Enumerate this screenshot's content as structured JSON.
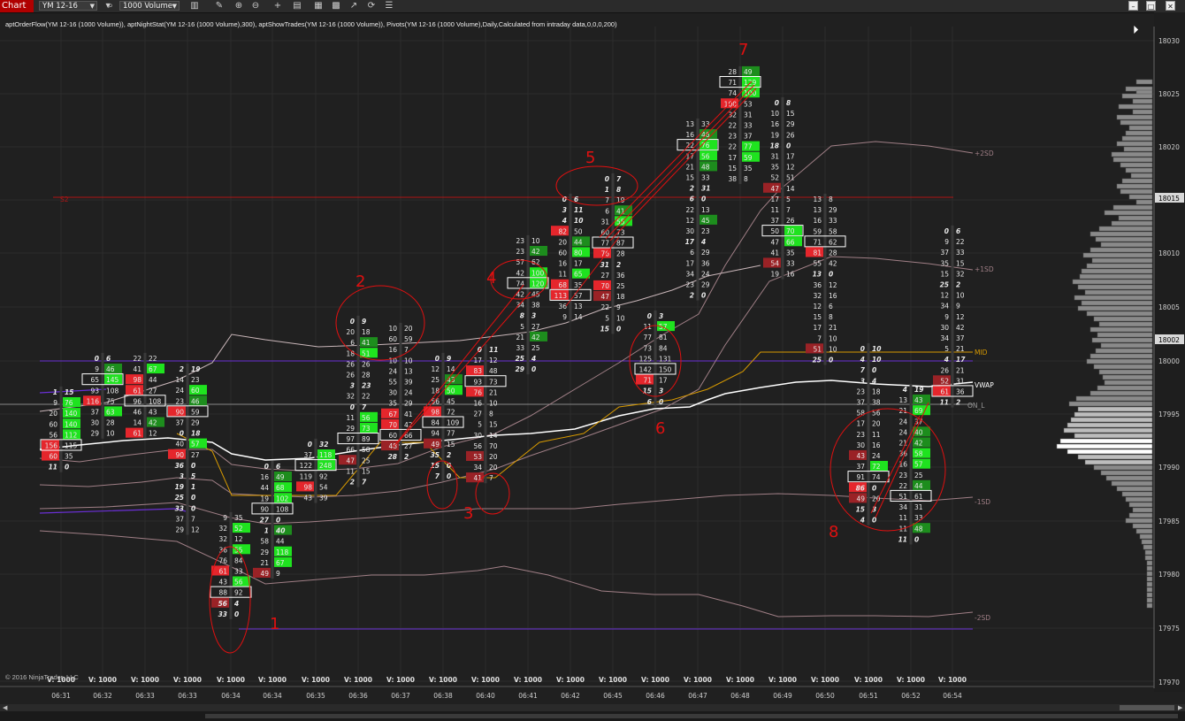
{
  "toolbar": {
    "chart_tab": "Chart",
    "instrument": "YM 12-16",
    "bar_type": "1000 Volume",
    "icons": [
      "bar-style-icon",
      "search-icon",
      "pencil-icon",
      "zoom-in-icon",
      "zoom-out-icon",
      "crosshair-icon",
      "properties-icon",
      "strategies-icon",
      "data-series-icon",
      "drawing-tools-icon",
      "refresh-icon",
      "menu-icon"
    ],
    "window_buttons": [
      "minimize",
      "maximize",
      "close"
    ]
  },
  "indicator_line": "aptOrderFlow(YM 12-16 (1000 Volume)), aptNightStat(YM 12-16 (1000 Volume),300), aptShowTrades(YM 12-16 (1000 Volume)), Pivots(YM 12-16 (1000 Volume),Daily,Calculated from intraday data,0,0,0,200)",
  "copyright": "© 2016 NinjaTrader, LLC",
  "colors": {
    "background": "#202020",
    "bid_strong": "#e5262c",
    "ask_strong": "#1fe31f",
    "annotation": "#e01010",
    "vwap": "#ffffff",
    "pivot_mid": "#d89a00",
    "pivot_s2": "#b01515",
    "on_level": "#9a40ff"
  },
  "price_axis": {
    "labels": [
      "18030",
      "18025",
      "18020",
      "18015",
      "18010",
      "18005",
      "18002",
      "18000",
      "17995",
      "17990",
      "17985",
      "17980",
      "17975",
      "17970"
    ],
    "current_labels": [
      "18015",
      "18002"
    ],
    "level_labels": [
      "+2SD",
      "+1SD",
      "MID",
      "VWAP",
      "ON_L",
      "-1SD",
      "-2SD",
      "S2"
    ]
  },
  "time_axis": {
    "labels": [
      "06:31",
      "06:32",
      "06:33",
      "06:33",
      "06:34",
      "06:34",
      "06:35",
      "06:36",
      "06:37",
      "06:38",
      "06:40",
      "06:41",
      "06:42",
      "06:45",
      "06:46",
      "06:47",
      "06:48",
      "06:49",
      "06:50",
      "06:51",
      "06:52",
      "06:54"
    ],
    "volume_label": "V: 1000"
  },
  "annotations": [
    "1",
    "2",
    "3",
    "4",
    "5",
    "6",
    "7",
    "8"
  ],
  "bars": [
    {
      "pairs": [
        [
          "1",
          "15"
        ],
        [
          "9",
          "76"
        ],
        [
          "20",
          "140"
        ],
        [
          "60",
          "140"
        ],
        [
          "56",
          "112"
        ],
        [
          "156",
          "115"
        ],
        [
          "60",
          "35"
        ],
        [
          "11",
          "0"
        ]
      ]
    },
    {
      "pairs": [
        [
          "0",
          "6"
        ],
        [
          "9",
          "46"
        ],
        [
          "65",
          "145"
        ],
        [
          "93",
          "108"
        ],
        [
          "116",
          "75"
        ],
        [
          "37",
          "63"
        ],
        [
          "30",
          "28"
        ],
        [
          "29",
          "10"
        ]
      ]
    },
    {
      "pairs": [
        [
          "22",
          "22"
        ],
        [
          "41",
          "67"
        ],
        [
          "98",
          "44"
        ],
        [
          "61",
          "27"
        ],
        [
          "96",
          "108"
        ],
        [
          "46",
          "43"
        ],
        [
          "14",
          "42"
        ],
        [
          "61",
          "12"
        ]
      ]
    },
    {
      "pairs": [
        [
          "2",
          "19"
        ],
        [
          "14",
          "23"
        ],
        [
          "24",
          "60"
        ],
        [
          "23",
          "46"
        ],
        [
          "90",
          "59"
        ],
        [
          "37",
          "29"
        ],
        [
          "0",
          "18"
        ],
        [
          "40",
          "57"
        ],
        [
          "90",
          "27"
        ],
        [
          "36",
          "0"
        ],
        [
          "3",
          "5"
        ],
        [
          "19",
          "1"
        ],
        [
          "25",
          "0"
        ],
        [
          "33",
          "0"
        ],
        [
          "37",
          "7"
        ],
        [
          "29",
          "12"
        ]
      ]
    },
    {
      "pairs": [
        [
          "9",
          "35"
        ],
        [
          "32",
          "52"
        ],
        [
          "32",
          "12"
        ],
        [
          "36",
          "55"
        ],
        [
          "76",
          "84"
        ],
        [
          "61",
          "33"
        ],
        [
          "43",
          "56"
        ],
        [
          "88",
          "92"
        ],
        [
          "56",
          "4"
        ],
        [
          "33",
          "0"
        ]
      ]
    },
    {
      "pairs": [
        [
          "0",
          "6"
        ],
        [
          "16",
          "49"
        ],
        [
          "44",
          "68"
        ],
        [
          "19",
          "102"
        ],
        [
          "90",
          "108"
        ],
        [
          "27",
          "0"
        ],
        [
          "1",
          "40"
        ],
        [
          "58",
          "44"
        ],
        [
          "29",
          "118"
        ],
        [
          "21",
          "67"
        ],
        [
          "49",
          "9"
        ]
      ]
    },
    {
      "pairs": [
        [
          "0",
          "32"
        ],
        [
          "37",
          "118"
        ],
        [
          "122",
          "248"
        ],
        [
          "119",
          "92"
        ],
        [
          "98",
          "54"
        ],
        [
          "43",
          "39"
        ]
      ]
    },
    {
      "pairs": [
        [
          "0",
          "9"
        ],
        [
          "20",
          "18"
        ],
        [
          "6",
          "41"
        ],
        [
          "18",
          "51"
        ],
        [
          "26",
          "26"
        ],
        [
          "26",
          "28"
        ],
        [
          "3",
          "23"
        ],
        [
          "32",
          "22"
        ],
        [
          "0",
          "7"
        ],
        [
          "11",
          "56"
        ],
        [
          "29",
          "73"
        ],
        [
          "97",
          "89"
        ],
        [
          "66",
          "58"
        ],
        [
          "47",
          "25"
        ],
        [
          "11",
          "15"
        ],
        [
          "2",
          "7"
        ]
      ]
    },
    {
      "pairs": [
        [
          "10",
          "20"
        ],
        [
          "60",
          "59"
        ],
        [
          "16",
          "7"
        ],
        [
          "10",
          "10"
        ],
        [
          "24",
          "13"
        ],
        [
          "55",
          "39"
        ],
        [
          "30",
          "24"
        ],
        [
          "35",
          "29"
        ],
        [
          "67",
          "41"
        ],
        [
          "70",
          "42"
        ],
        [
          "60",
          "66"
        ],
        [
          "48",
          "27"
        ],
        [
          "28",
          "2"
        ]
      ]
    },
    {
      "pairs": [
        [
          "0",
          "9"
        ],
        [
          "12",
          "14"
        ],
        [
          "25",
          "43"
        ],
        [
          "18",
          "50"
        ],
        [
          "56",
          "45"
        ],
        [
          "98",
          "72"
        ],
        [
          "84",
          "109"
        ],
        [
          "94",
          "77"
        ],
        [
          "49",
          "15"
        ],
        [
          "35",
          "2"
        ],
        [
          "15",
          "0"
        ],
        [
          "7",
          "0"
        ]
      ]
    },
    {
      "pairs": [
        [
          "0",
          "11"
        ],
        [
          "17",
          "12"
        ],
        [
          "83",
          "48"
        ],
        [
          "93",
          "73"
        ],
        [
          "76",
          "21"
        ],
        [
          "16",
          "10"
        ],
        [
          "27",
          "8"
        ],
        [
          "5",
          "15"
        ],
        [
          "30",
          "14"
        ],
        [
          "56",
          "70"
        ],
        [
          "53",
          "20"
        ],
        [
          "34",
          "20"
        ],
        [
          "41",
          "7"
        ]
      ]
    },
    {
      "pairs": [
        [
          "23",
          "10"
        ],
        [
          "23",
          "42"
        ],
        [
          "57",
          "62"
        ],
        [
          "42",
          "100"
        ],
        [
          "74",
          "120"
        ],
        [
          "42",
          "45"
        ],
        [
          "34",
          "38"
        ],
        [
          "8",
          "3"
        ],
        [
          "5",
          "27"
        ],
        [
          "21",
          "42"
        ],
        [
          "33",
          "25"
        ],
        [
          "25",
          "4"
        ],
        [
          "29",
          "0"
        ]
      ]
    },
    {
      "pairs": [
        [
          "0",
          "6"
        ],
        [
          "3",
          "11"
        ],
        [
          "4",
          "10"
        ],
        [
          "82",
          "50"
        ],
        [
          "20",
          "44"
        ],
        [
          "60",
          "80"
        ],
        [
          "16",
          "17"
        ],
        [
          "11",
          "65"
        ],
        [
          "68",
          "35"
        ],
        [
          "113",
          "57"
        ],
        [
          "36",
          "13"
        ],
        [
          "9",
          "14"
        ]
      ]
    },
    {
      "pairs": [
        [
          "0",
          "7"
        ],
        [
          "1",
          "8"
        ],
        [
          "7",
          "19"
        ],
        [
          "6",
          "41"
        ],
        [
          "31",
          "55"
        ],
        [
          "60",
          "73"
        ],
        [
          "77",
          "87"
        ],
        [
          "76",
          "28"
        ],
        [
          "31",
          "2"
        ],
        [
          "27",
          "36"
        ],
        [
          "70",
          "25"
        ],
        [
          "47",
          "18"
        ],
        [
          "22",
          "9"
        ],
        [
          "5",
          "10"
        ],
        [
          "15",
          "0"
        ]
      ]
    },
    {
      "pairs": [
        [
          "0",
          "3"
        ],
        [
          "11",
          "57"
        ],
        [
          "77",
          "81"
        ],
        [
          "73",
          "84"
        ],
        [
          "125",
          "131"
        ],
        [
          "142",
          "150"
        ],
        [
          "71",
          "17"
        ],
        [
          "15",
          "3"
        ],
        [
          "6",
          "0"
        ]
      ]
    },
    {
      "pairs": [
        [
          "13",
          "33"
        ],
        [
          "16",
          "46"
        ],
        [
          "22",
          "76"
        ],
        [
          "17",
          "56"
        ],
        [
          "21",
          "48"
        ],
        [
          "15",
          "33"
        ],
        [
          "2",
          "31"
        ],
        [
          "6",
          "0"
        ],
        [
          "22",
          "13"
        ],
        [
          "12",
          "45"
        ],
        [
          "30",
          "23"
        ],
        [
          "17",
          "4"
        ],
        [
          "6",
          "29"
        ],
        [
          "17",
          "36"
        ],
        [
          "34",
          "24"
        ],
        [
          "23",
          "29"
        ],
        [
          "2",
          "0"
        ]
      ]
    },
    {
      "pairs": [
        [
          "28",
          "49"
        ],
        [
          "71",
          "129"
        ],
        [
          "74",
          "100"
        ],
        [
          "100",
          "53"
        ],
        [
          "32",
          "31"
        ],
        [
          "22",
          "33"
        ],
        [
          "23",
          "37"
        ],
        [
          "22",
          "77"
        ],
        [
          "17",
          "59"
        ],
        [
          "15",
          "35"
        ],
        [
          "38",
          "8"
        ]
      ]
    },
    {
      "pairs": [
        [
          "0",
          "8"
        ],
        [
          "10",
          "15"
        ],
        [
          "16",
          "29"
        ],
        [
          "19",
          "26"
        ],
        [
          "18",
          "0"
        ],
        [
          "31",
          "17"
        ],
        [
          "35",
          "12"
        ],
        [
          "52",
          "51"
        ],
        [
          "47",
          "14"
        ],
        [
          "17",
          "5"
        ],
        [
          "11",
          "7"
        ],
        [
          "37",
          "26"
        ],
        [
          "50",
          "70"
        ],
        [
          "47",
          "66"
        ],
        [
          "41",
          "35"
        ],
        [
          "54",
          "33"
        ],
        [
          "19",
          "16"
        ]
      ]
    },
    {
      "pairs": [
        [
          "13",
          "8"
        ],
        [
          "13",
          "29"
        ],
        [
          "16",
          "33"
        ],
        [
          "59",
          "58"
        ],
        [
          "71",
          "62"
        ],
        [
          "81",
          "28"
        ],
        [
          "55",
          "42"
        ],
        [
          "13",
          "0"
        ],
        [
          "36",
          "12"
        ],
        [
          "32",
          "16"
        ],
        [
          "12",
          "6"
        ],
        [
          "15",
          "8"
        ],
        [
          "17",
          "21"
        ],
        [
          "7",
          "10"
        ],
        [
          "51",
          "10"
        ],
        [
          "25",
          "0"
        ]
      ]
    },
    {
      "pairs": [
        [
          "0",
          "10"
        ],
        [
          "4",
          "10"
        ],
        [
          "7",
          "0"
        ],
        [
          "3",
          "4"
        ],
        [
          "23",
          "18"
        ],
        [
          "37",
          "38"
        ],
        [
          "58",
          "56"
        ],
        [
          "17",
          "20"
        ],
        [
          "23",
          "11"
        ],
        [
          "30",
          "16"
        ],
        [
          "43",
          "24"
        ],
        [
          "37",
          "72"
        ],
        [
          "91",
          "74"
        ],
        [
          "86",
          "0"
        ],
        [
          "49",
          "20"
        ],
        [
          "15",
          "3"
        ],
        [
          "4",
          "0"
        ]
      ]
    },
    {
      "pairs": [
        [
          "4",
          "19"
        ],
        [
          "13",
          "43"
        ],
        [
          "21",
          "69"
        ],
        [
          "24",
          "37"
        ],
        [
          "24",
          "40"
        ],
        [
          "21",
          "42"
        ],
        [
          "36",
          "58"
        ],
        [
          "16",
          "57"
        ],
        [
          "23",
          "25"
        ],
        [
          "22",
          "44"
        ],
        [
          "51",
          "61"
        ],
        [
          "34",
          "31"
        ],
        [
          "11",
          "33"
        ],
        [
          "11",
          "48"
        ],
        [
          "11",
          "0"
        ]
      ]
    },
    {
      "pairs": [
        [
          "0",
          "6"
        ],
        [
          "9",
          "22"
        ],
        [
          "37",
          "33"
        ],
        [
          "35",
          "15"
        ],
        [
          "15",
          "32"
        ],
        [
          "25",
          "2"
        ],
        [
          "12",
          "10"
        ],
        [
          "34",
          "9"
        ],
        [
          "9",
          "12"
        ],
        [
          "30",
          "42"
        ],
        [
          "34",
          "37"
        ],
        [
          "5",
          "21"
        ],
        [
          "4",
          "17"
        ],
        [
          "26",
          "21"
        ],
        [
          "52",
          "31"
        ],
        [
          "61",
          "36"
        ],
        [
          "11",
          "2"
        ]
      ]
    }
  ]
}
